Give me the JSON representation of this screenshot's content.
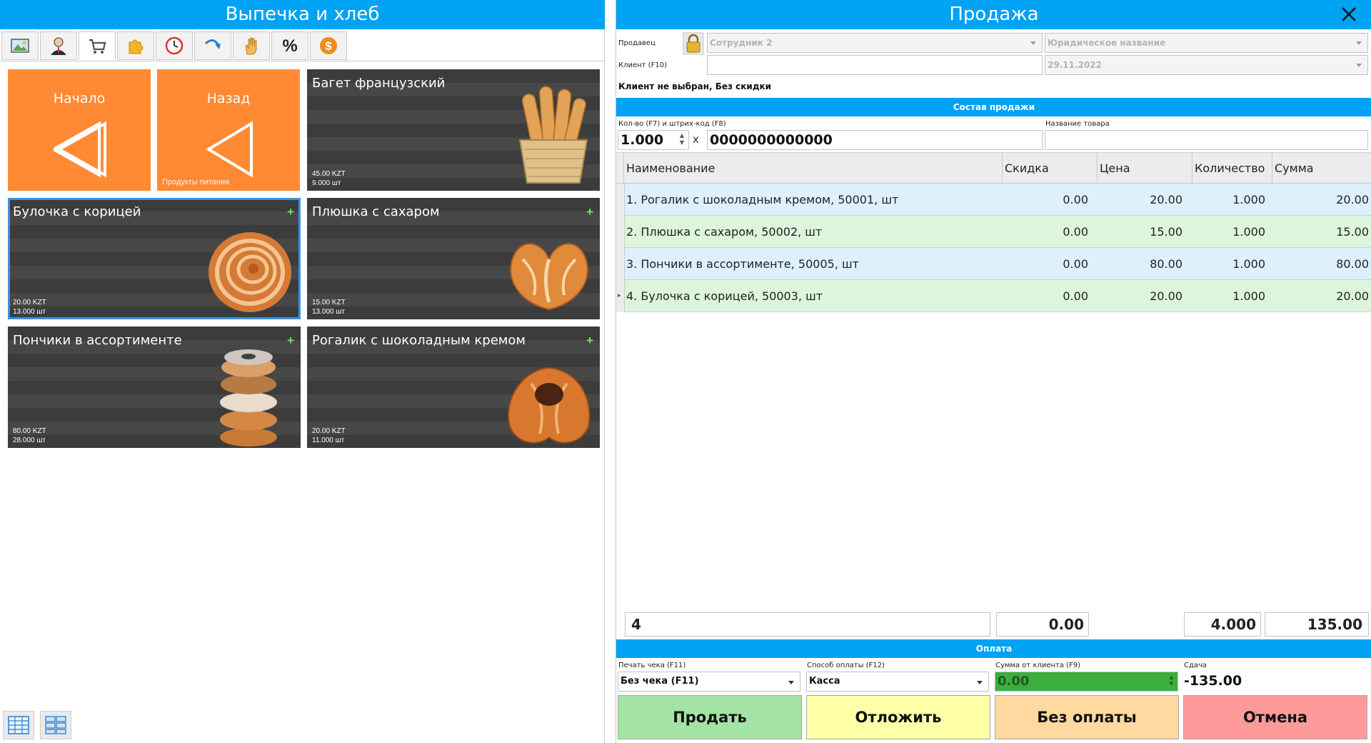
{
  "left": {
    "title": "Выпечка и хлеб",
    "toolbar": [
      {
        "icon": "image-icon"
      },
      {
        "icon": "user-icon"
      },
      {
        "icon": "cart-icon"
      },
      {
        "icon": "puzzle-icon"
      },
      {
        "icon": "clock-icon"
      },
      {
        "icon": "redo-arrow-icon"
      },
      {
        "icon": "hand-icon"
      },
      {
        "icon": "percent-icon"
      },
      {
        "icon": "dollar-icon"
      }
    ],
    "nav": {
      "home_label": "Начало",
      "back_label": "Назад",
      "back_sub": "Продукты питания"
    },
    "products": [
      {
        "name": "Багет французский",
        "price": "45.00 KZT",
        "stock": "9.000 шт",
        "image": "baguette-basket-image",
        "plus": ""
      },
      {
        "name": "Булочка с корицей",
        "price": "20.00 KZT",
        "stock": "13.000 шт",
        "image": "cinnamon-roll-image",
        "plus": "+"
      },
      {
        "name": "Плюшка с сахаром",
        "price": "15.00 KZT",
        "stock": "13.000 шт",
        "image": "sugar-bun-image",
        "plus": "+"
      },
      {
        "name": "Пончики в ассортименте",
        "price": "80.00 KZT",
        "stock": "28.000 шт",
        "image": "donut-stack-image",
        "plus": "+"
      },
      {
        "name": "Рогалик с шоколадным кремом",
        "price": "20.00 KZT",
        "stock": "11.000 шт",
        "image": "croissant-image",
        "plus": "+"
      }
    ]
  },
  "right": {
    "title": "Продажа",
    "seller_label": "Продавец",
    "seller_value": "Сотрудник 2",
    "legal_name_placeholder": "Юридическое название",
    "client_label": "Клиент (F10)",
    "client_value": "",
    "date_value": "29.11.2022",
    "client_status": "Клиент не выбран, Без скидки",
    "composition_title": "Состав продажи",
    "qty_label": "Кол-во (F7) и штрих-код (F8)",
    "qty_value": "1.000",
    "times": "x",
    "barcode_value": "0000000000000",
    "product_name_label": "Название товара",
    "product_name_value": "",
    "columns": [
      "Наименование",
      "Скидка",
      "Цена",
      "Количество",
      "Сумма"
    ],
    "rows": [
      {
        "name": "1. Рогалик с шоколадным кремом, 50001, шт",
        "discount": "0.00",
        "price": "20.00",
        "qty": "1.000",
        "sum": "20.00"
      },
      {
        "name": "2. Плюшка с сахаром, 50002, шт",
        "discount": "0.00",
        "price": "15.00",
        "qty": "1.000",
        "sum": "15.00"
      },
      {
        "name": "3. Пончики в ассортименте, 50005, шт",
        "discount": "0.00",
        "price": "80.00",
        "qty": "1.000",
        "sum": "80.00"
      },
      {
        "name": "4. Булочка с корицей, 50003, шт",
        "discount": "0.00",
        "price": "20.00",
        "qty": "1.000",
        "sum": "20.00"
      }
    ],
    "totals": {
      "count": "4",
      "discount": "0.00",
      "qty": "4.000",
      "sum": "135.00"
    },
    "payment_title": "Оплата",
    "receipt_label": "Печать чека (F11)",
    "receipt_value": "Без чека (F11)",
    "method_label": "Способ оплаты (F12)",
    "method_value": "Касса",
    "client_sum_label": "Сумма от клиента (F9)",
    "client_sum_value": "0.00",
    "change_label": "Сдача",
    "change_value": "-135.00",
    "buttons": {
      "sell": "Продать",
      "postpone": "Отложить",
      "no_payment": "Без оплаты",
      "cancel": "Отмена"
    }
  },
  "colors": {
    "accent": "#00a2f4",
    "nav_tile": "#ff8a33",
    "sell": "#a3e3a3",
    "postpone": "#ffffa8",
    "no_payment": "#ffd9a0",
    "cancel": "#ff9a9a",
    "client_sum_bg": "#3cae3c"
  }
}
